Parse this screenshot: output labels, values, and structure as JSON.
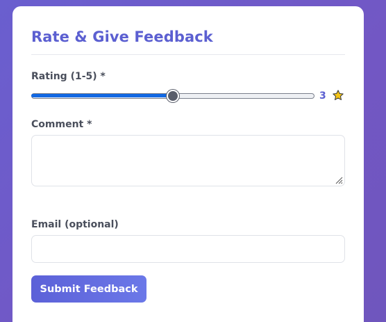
{
  "form": {
    "title": "Rate & Give Feedback",
    "rating": {
      "label": "Rating (1-5) *",
      "value": "3",
      "min": 1,
      "max": 5,
      "fill_fraction": 0.5,
      "icon": "star-icon"
    },
    "comment": {
      "label": "Comment *",
      "value": "",
      "placeholder": ""
    },
    "email": {
      "label": "Email (optional)",
      "value": "",
      "placeholder": ""
    },
    "submit_label": "Submit Feedback"
  },
  "colors": {
    "accent": "#5b5fd1",
    "slider_fill": "#1168e3",
    "background": "#6a5fcf",
    "star": "#f5c518"
  }
}
